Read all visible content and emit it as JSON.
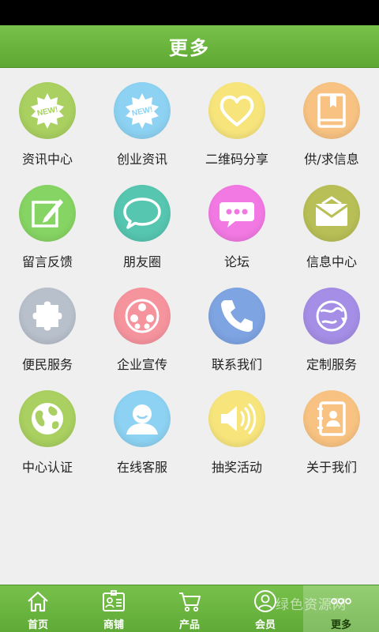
{
  "header": {
    "title": "更多"
  },
  "grid": [
    {
      "label": "资讯中心",
      "icon": "new-badge-icon",
      "color": "#a9d060"
    },
    {
      "label": "创业资讯",
      "icon": "new-badge-icon",
      "color": "#8dd2f2"
    },
    {
      "label": "二维码分享",
      "icon": "heart-icon",
      "color": "#f7e57c"
    },
    {
      "label": "供/求信息",
      "icon": "book-icon",
      "color": "#f8c382"
    },
    {
      "label": "留言反馈",
      "icon": "edit-icon",
      "color": "#86d463"
    },
    {
      "label": "朋友圈",
      "icon": "chat-bubble-icon",
      "color": "#56c6b0"
    },
    {
      "label": "论坛",
      "icon": "message-dots-icon",
      "color": "#f279e3"
    },
    {
      "label": "信息中心",
      "icon": "envelope-icon",
      "color": "#b8bf56"
    },
    {
      "label": "便民服务",
      "icon": "puzzle-icon",
      "color": "#b8c0cc"
    },
    {
      "label": "企业宣传",
      "icon": "film-reel-icon",
      "color": "#f6949e"
    },
    {
      "label": "联系我们",
      "icon": "phone-icon",
      "color": "#7ea4e2"
    },
    {
      "label": "定制服务",
      "icon": "globe-arrows-icon",
      "color": "#a58ee6"
    },
    {
      "label": "中心认证",
      "icon": "earth-icon",
      "color": "#a9d060"
    },
    {
      "label": "在线客服",
      "icon": "user-icon",
      "color": "#8dd2f2"
    },
    {
      "label": "抽奖活动",
      "icon": "speaker-icon",
      "color": "#f7e57c"
    },
    {
      "label": "关于我们",
      "icon": "contacts-icon",
      "color": "#f8c382"
    }
  ],
  "tabs": [
    {
      "label": "首页",
      "icon": "home-icon"
    },
    {
      "label": "商铺",
      "icon": "shop-id-icon"
    },
    {
      "label": "产品",
      "icon": "cart-icon"
    },
    {
      "label": "会员",
      "icon": "member-icon"
    },
    {
      "label": "更多",
      "icon": "more-dots-icon",
      "active": true
    }
  ],
  "watermark": "绿色资源网"
}
